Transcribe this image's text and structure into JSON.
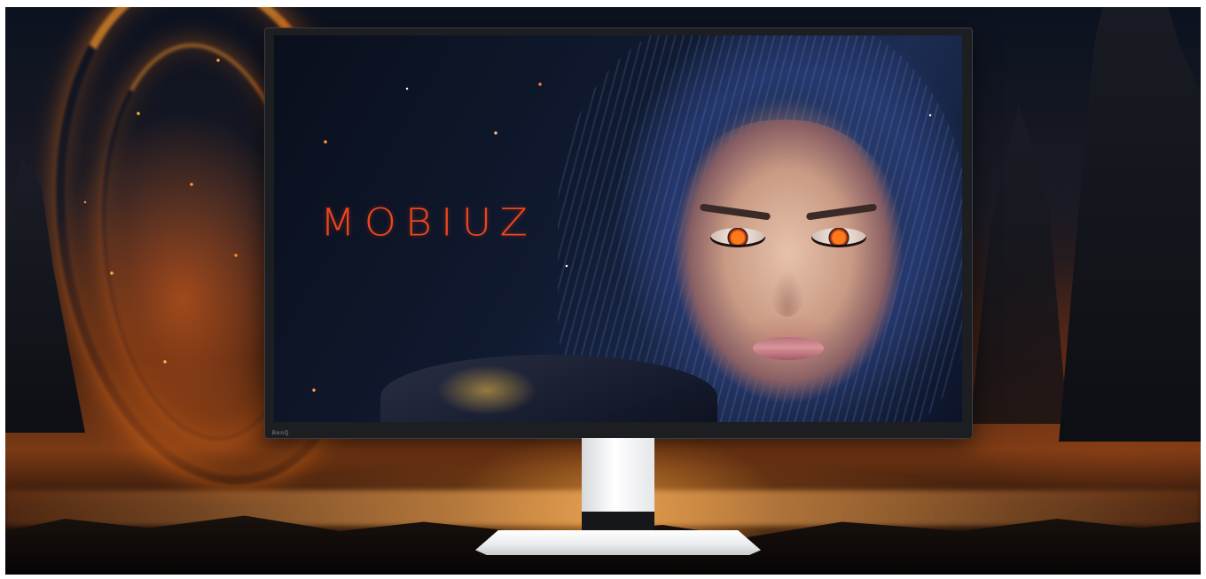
{
  "image": {
    "description_free": true,
    "colors": {
      "logo_accent": "#f0451c",
      "bezel": "#1c1e22",
      "stand": "#ffffff"
    }
  },
  "screen": {
    "logo_text": "MOBIUZ"
  },
  "bezel": {
    "brand_label": "BenQ"
  }
}
